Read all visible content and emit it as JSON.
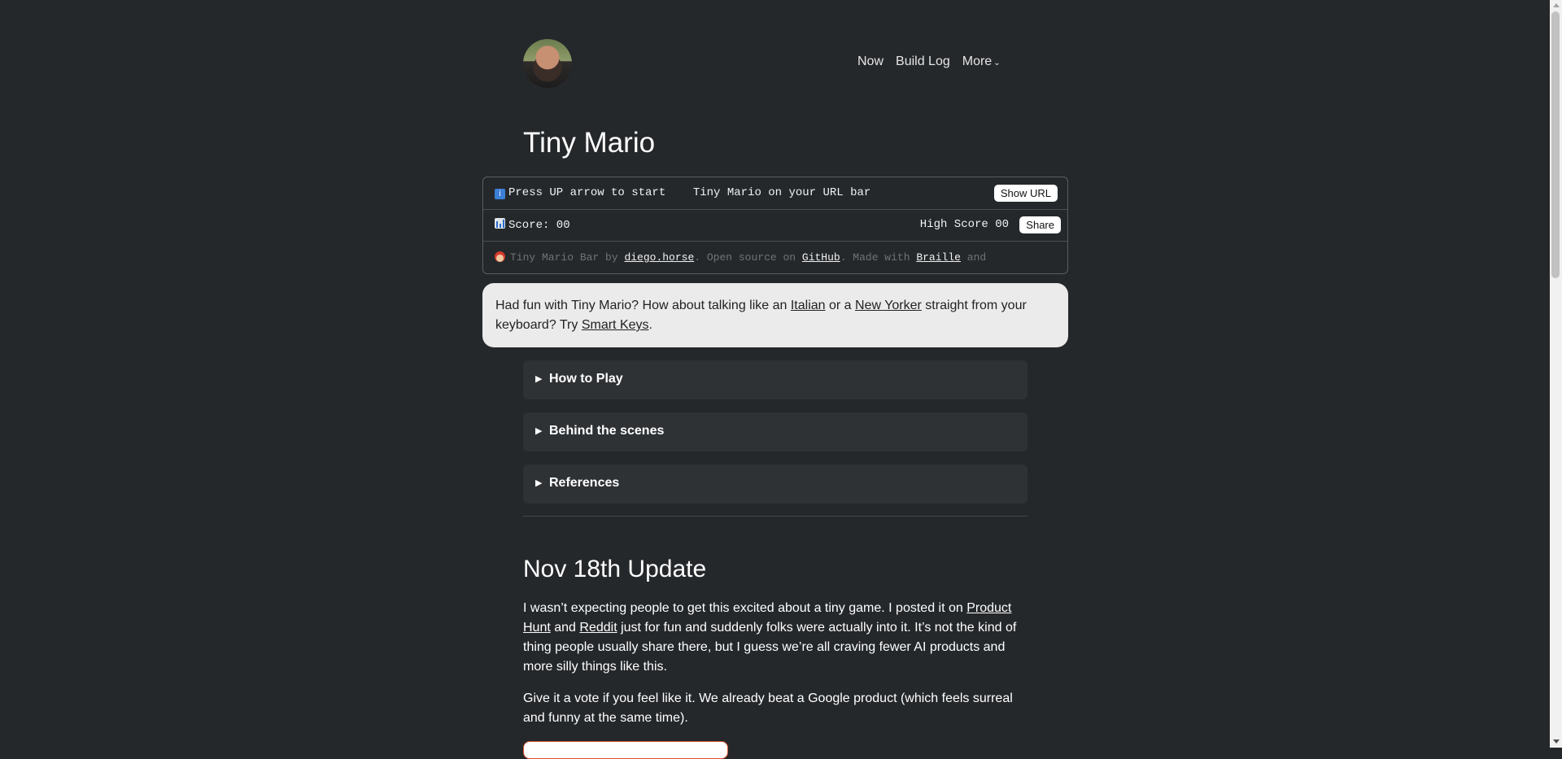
{
  "header": {
    "nav": [
      "Now",
      "Build Log",
      "More"
    ]
  },
  "page": {
    "title": "Tiny Mario"
  },
  "mario_bar": {
    "row1_text": "Press UP arrow to start    Tiny Mario on your URL bar",
    "show_url_label": "Show URL",
    "score_text": "Score: 00",
    "high_score_text": "High Score 00",
    "share_label": "Share",
    "credit_prefix": "Tiny Mario Bar by ",
    "credit_link": "diego.horse",
    "credit_mid": ". Open source on ",
    "github_link": "GitHub",
    "credit_mid2": ". Made with ",
    "braille_link": "Braille",
    "credit_suffix": " and"
  },
  "promo": {
    "t1": "Had fun with Tiny Mario? How about talking like an ",
    "italian": "Italian",
    "t2": " or a ",
    "new_yorker": "New Yorker",
    "t3": " straight from your keyboard? Try ",
    "smart_keys": "Smart Keys",
    "t4": "."
  },
  "sections": [
    "How to Play",
    "Behind the scenes",
    "References"
  ],
  "update": {
    "heading": "Nov 18th Update",
    "p1_a": "I wasn’t expecting people to get this excited about a tiny game. I posted it on ",
    "product_hunt": "Product Hunt",
    "p1_b": " and ",
    "reddit": "Reddit",
    "p1_c": " just for fun and suddenly folks were actually into it. It’s not the kind of thing people usually share there, but I guess we’re all craving fewer AI products and more silly things like this.",
    "p2": "Give it a vote if you feel like it. We already beat a Google product (which feels surreal and funny at the same time)."
  },
  "colors": {
    "background": "#25282b",
    "panel": "#2f3235",
    "promo_bg": "#ebebeb",
    "product_hunt_accent": "#da552f"
  }
}
